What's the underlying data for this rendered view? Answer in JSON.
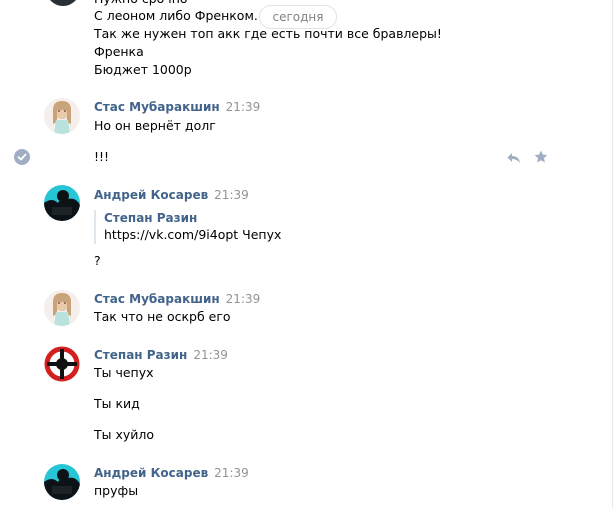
{
  "top_block": {
    "line_partial": "Нужно срочно",
    "lines": [
      "С леоном либо Френком.",
      "Так же нужен топ акк где есть почти все бравлеры!",
      "Френка",
      "Бюджет 1000р"
    ]
  },
  "date_separator": "сегодня",
  "messages": [
    {
      "author": "Стас Мубаракшин",
      "time": "21:39",
      "lines": [
        "Но он вернёт долг",
        "!!!"
      ]
    },
    {
      "author": "Андрей Косарев",
      "time": "21:39",
      "quote": {
        "author": "Степан Разин",
        "text": "https://vk.com/9i4opt Чепух"
      },
      "lines": [
        "?"
      ]
    },
    {
      "author": "Стас Мубаракшин",
      "time": "21:39",
      "lines": [
        "Так что не оскрб его"
      ]
    },
    {
      "author": "Степан Разин",
      "time": "21:39",
      "lines": [
        "Ты чепух",
        "Ты кид",
        "Ты хуйло"
      ]
    },
    {
      "author": "Андрей Косарев",
      "time": "21:39",
      "lines": [
        "пруфы"
      ]
    }
  ],
  "icons": {
    "selected": "check-circle-icon",
    "reply": "reply-arrow-icon",
    "favorite": "star-icon"
  },
  "colors": {
    "author_link": "#42648b",
    "time_gray": "#939393",
    "icon_gray": "#a0aec4"
  }
}
